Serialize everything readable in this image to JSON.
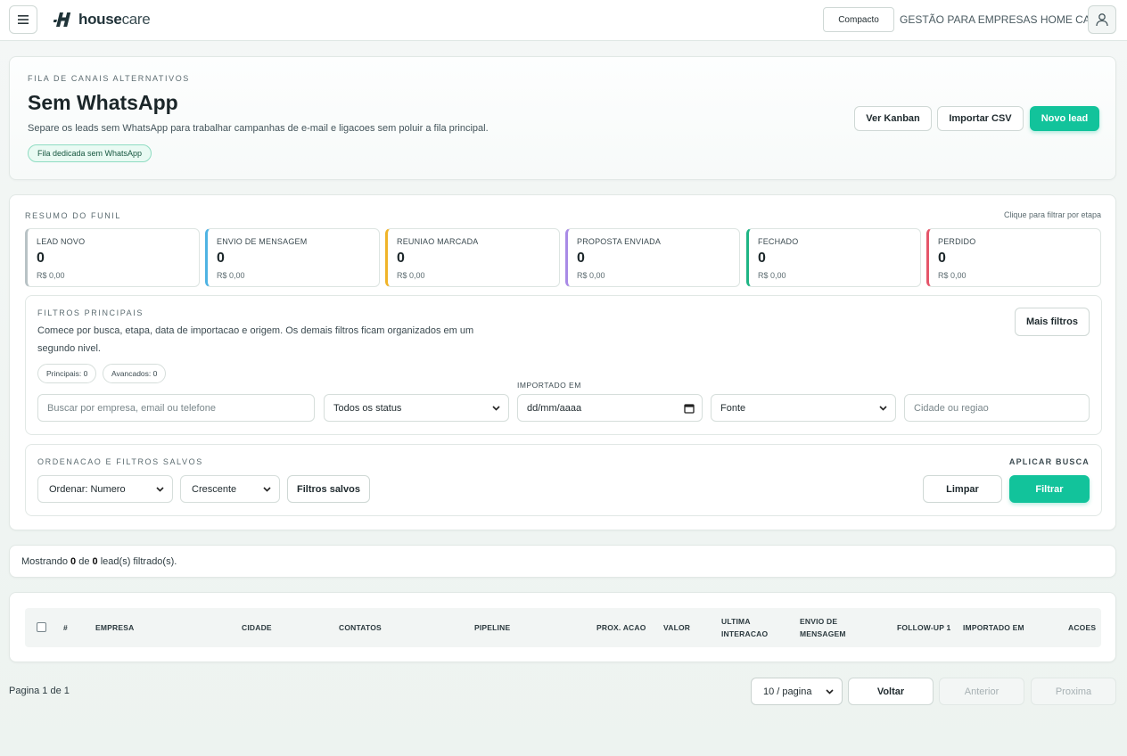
{
  "header": {
    "logo_bold": "house",
    "logo_light": "care",
    "compact_label": "Compacto",
    "brand_caption": "GESTÃO PARA EMPRESAS HOME CARE"
  },
  "hero": {
    "eyebrow": "FILA DE CANAIS ALTERNATIVOS",
    "title": "Sem WhatsApp",
    "description": "Separe os leads sem WhatsApp para trabalhar campanhas de e-mail e ligacoes sem poluir a fila principal.",
    "pill": "Fila dedicada sem WhatsApp",
    "buttons": {
      "kanban": "Ver Kanban",
      "import": "Importar CSV",
      "new_lead": "Novo lead"
    }
  },
  "funnel": {
    "title": "RESUMO DO FUNIL",
    "hint": "Clique para filtrar por etapa",
    "stages": [
      {
        "label": "LEAD NOVO",
        "count": "0",
        "value": "R$ 0,00",
        "color": "#b8c2c5"
      },
      {
        "label": "ENVIO DE MENSAGEM",
        "count": "0",
        "value": "R$ 0,00",
        "color": "#4fb3e3"
      },
      {
        "label": "REUNIAO MARCADA",
        "count": "0",
        "value": "R$ 0,00",
        "color": "#f0b429"
      },
      {
        "label": "PROPOSTA ENVIADA",
        "count": "0",
        "value": "R$ 0,00",
        "color": "#a98ae6"
      },
      {
        "label": "FECHADO",
        "count": "0",
        "value": "R$ 0,00",
        "color": "#1fb585"
      },
      {
        "label": "PERDIDO",
        "count": "0",
        "value": "R$ 0,00",
        "color": "#e5566a"
      }
    ]
  },
  "filters": {
    "title": "FILTROS PRINCIPAIS",
    "description": "Comece por busca, etapa, data de importacao e origem. Os demais filtros ficam organizados em um segundo nivel.",
    "more_filters": "Mais filtros",
    "chip_principal": "Principais: 0",
    "chip_advanced": "Avancados: 0",
    "search_placeholder": "Buscar por empresa, email ou telefone",
    "status_value": "Todos os status",
    "imported_label": "IMPORTADO EM",
    "date_placeholder": "dd/mm/aaaa",
    "source_value": "Fonte",
    "city_placeholder": "Cidade ou regiao"
  },
  "sorting": {
    "title": "ORDENACAO E FILTROS SALVOS",
    "apply_label": "APLICAR BUSCA",
    "order_value": "Ordenar: Numero",
    "direction_value": "Crescente",
    "saved_filters": "Filtros salvos",
    "clear": "Limpar",
    "filter": "Filtrar"
  },
  "results": {
    "prefix": "Mostrando",
    "shown": "0",
    "middle": "de",
    "total": "0",
    "suffix": "lead(s) filtrado(s)."
  },
  "table": {
    "columns": [
      "#",
      "EMPRESA",
      "CIDADE",
      "CONTATOS",
      "PIPELINE",
      "PROX. ACAO",
      "VALOR",
      "ULTIMA INTERACAO",
      "ENVIO DE MENSAGEM",
      "FOLLOW-UP 1",
      "IMPORTADO EM",
      "ACOES"
    ]
  },
  "pagination": {
    "info": "Pagina 1 de 1",
    "per_page": "10 / pagina",
    "back": "Voltar",
    "previous": "Anterior",
    "next": "Proxima"
  }
}
